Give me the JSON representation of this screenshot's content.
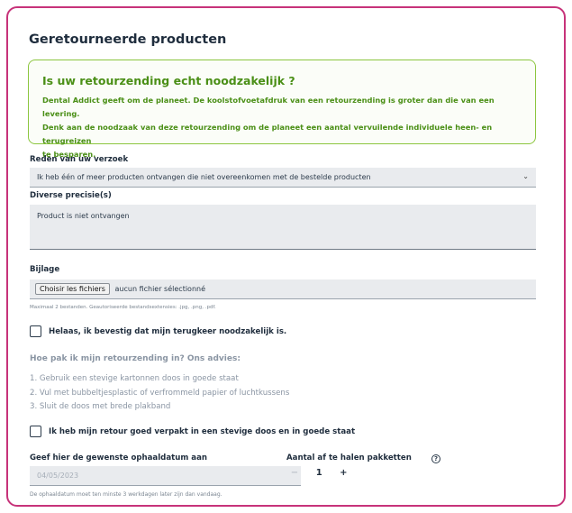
{
  "page": {
    "title": "Geretourneerde producten"
  },
  "alert": {
    "title": "Is uw retourzending echt noodzakelijk ?",
    "line1": "Dental Addict geeft om de planeet. De koolstofvoetafdruk van een retourzending is groter dan die van een levering.",
    "line2": "Denk aan de noodzaak van deze retourzending om de planeet een aantal vervuilende individuele heen- en terugreizen",
    "line3": "te besparen."
  },
  "reason": {
    "label": "Reden van uw verzoek",
    "selected": "Ik heb één of meer producten ontvangen die niet overeenkomen met de bestelde producten"
  },
  "precision": {
    "label": "Diverse precisie(s)",
    "value": "Product is niet ontvangen"
  },
  "attachment": {
    "label": "Bijlage",
    "button": "Choisir les fichiers",
    "status": "aucun fichier sélectionné",
    "hint": "Maximaal 2 bestanden. Geautoriseerde bestandsextensies: .jpg, .png, .pdf."
  },
  "confirm_needed": {
    "label": "Helaas, ik bevestig dat mijn terugkeer noodzakelijk is."
  },
  "advice": {
    "title": "Hoe pak ik mijn retourzending in? Ons advies:",
    "steps": [
      "1. Gebruik een stevige kartonnen doos in goede staat",
      "2. Vul met bubbeltjesplastic of verfrommeld papier of luchtkussens",
      "3. Sluit de doos met brede plakband"
    ]
  },
  "confirm_packed": {
    "label": "Ik heb mijn retour goed verpakt in een stevige doos en in goede staat"
  },
  "pickup": {
    "label": "Geef hier de gewenste ophaaldatum aan",
    "value": "04/05/2023",
    "hint": "De ophaaldatum moet ten minste 3 werkdagen later zijn dan vandaag."
  },
  "packages": {
    "label": "Aantal af te halen pakketten",
    "minus": "−",
    "quantity": "1",
    "plus": "+",
    "help": "?"
  },
  "colors": {
    "border_accent": "#c7337a",
    "alert_green": "#4a8f16"
  }
}
